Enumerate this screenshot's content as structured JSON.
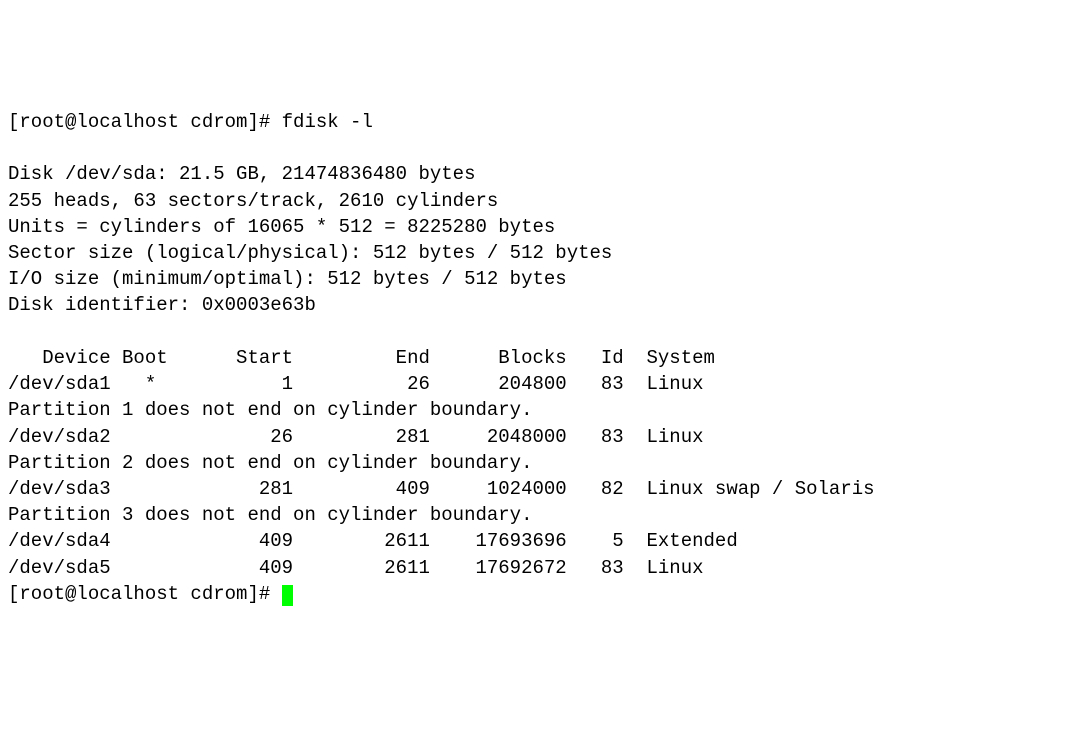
{
  "prompt1": "[root@localhost cdrom]# fdisk -l",
  "blank1": "",
  "disk_line": "Disk /dev/sda: 21.5 GB, 21474836480 bytes",
  "geom_line": "255 heads, 63 sectors/track, 2610 cylinders",
  "units_line": "Units = cylinders of 16065 * 512 = 8225280 bytes",
  "sector_line": "Sector size (logical/physical): 512 bytes / 512 bytes",
  "io_line": "I/O size (minimum/optimal): 512 bytes / 512 bytes",
  "ident_line": "Disk identifier: 0x0003e63b",
  "blank2": "",
  "header": "   Device Boot      Start         End      Blocks   Id  System",
  "row1": "/dev/sda1   *           1          26      204800   83  Linux",
  "warn1": "Partition 1 does not end on cylinder boundary.",
  "row2": "/dev/sda2              26         281     2048000   83  Linux",
  "warn2": "Partition 2 does not end on cylinder boundary.",
  "row3": "/dev/sda3             281         409     1024000   82  Linux swap / Solaris",
  "warn3": "Partition 3 does not end on cylinder boundary.",
  "row4": "/dev/sda4             409        2611    17693696    5  Extended",
  "row5": "/dev/sda5             409        2611    17692672   83  Linux",
  "prompt2": "[root@localhost cdrom]# ",
  "chart_data": {
    "type": "table",
    "title": "fdisk -l — /dev/sda",
    "disk": {
      "device": "/dev/sda",
      "size_human": "21.5 GB",
      "size_bytes": 21474836480,
      "heads": 255,
      "sectors_per_track": 63,
      "cylinders": 2610,
      "unit_cylinders_sectors": 16065,
      "sector_bytes": 512,
      "unit_bytes": 8225280,
      "sector_size_logical": 512,
      "sector_size_physical": 512,
      "io_min": 512,
      "io_opt": 512,
      "identifier": "0x0003e63b"
    },
    "columns": [
      "Device",
      "Boot",
      "Start",
      "End",
      "Blocks",
      "Id",
      "System"
    ],
    "rows": [
      {
        "Device": "/dev/sda1",
        "Boot": "*",
        "Start": 1,
        "End": 26,
        "Blocks": 204800,
        "Id": "83",
        "System": "Linux",
        "warning": "Partition 1 does not end on cylinder boundary."
      },
      {
        "Device": "/dev/sda2",
        "Boot": "",
        "Start": 26,
        "End": 281,
        "Blocks": 2048000,
        "Id": "83",
        "System": "Linux",
        "warning": "Partition 2 does not end on cylinder boundary."
      },
      {
        "Device": "/dev/sda3",
        "Boot": "",
        "Start": 281,
        "End": 409,
        "Blocks": 1024000,
        "Id": "82",
        "System": "Linux swap / Solaris",
        "warning": "Partition 3 does not end on cylinder boundary."
      },
      {
        "Device": "/dev/sda4",
        "Boot": "",
        "Start": 409,
        "End": 2611,
        "Blocks": 17693696,
        "Id": "5",
        "System": "Extended"
      },
      {
        "Device": "/dev/sda5",
        "Boot": "",
        "Start": 409,
        "End": 2611,
        "Blocks": 17692672,
        "Id": "83",
        "System": "Linux"
      }
    ]
  }
}
